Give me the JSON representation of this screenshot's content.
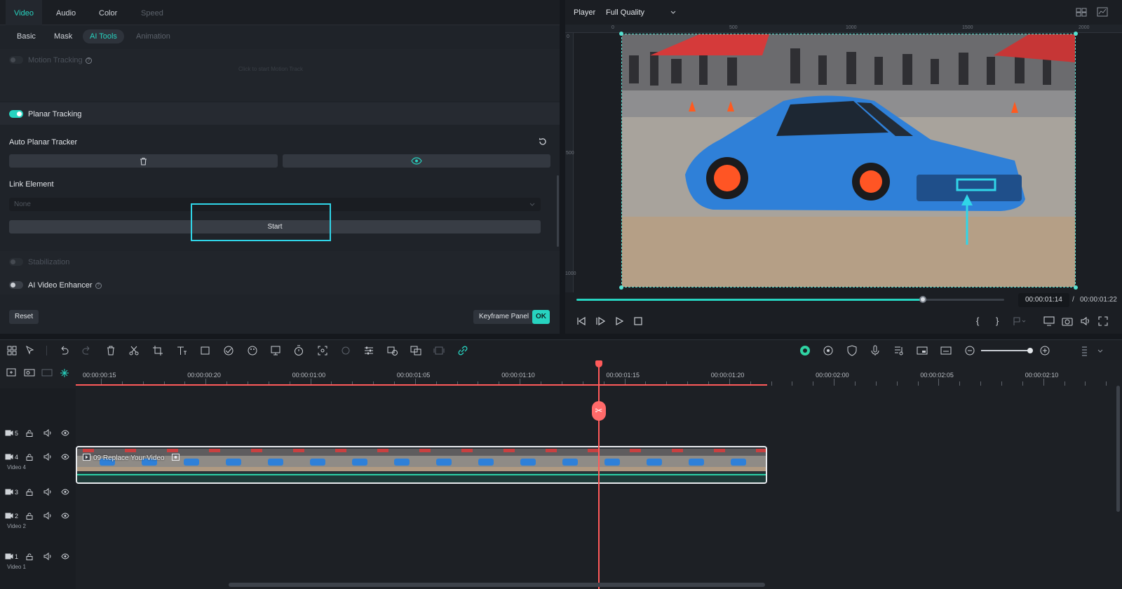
{
  "tabs": [
    "Video",
    "Audio",
    "Color",
    "Speed"
  ],
  "subtabs": [
    "Basic",
    "Mask",
    "AI Tools",
    "Animation"
  ],
  "sections": {
    "motion_tracking": "Motion Tracking",
    "motion_tracking_hint": "Click to start Motion Track",
    "planar_tracking": "Planar Tracking",
    "auto_planar_tracker": "Auto Planar Tracker",
    "link_element": "Link Element",
    "link_element_value": "None",
    "start_label": "Start",
    "stabilization": "Stabilization",
    "ai_video_enhancer": "AI Video Enhancer"
  },
  "footer": {
    "reset": "Reset",
    "keyframe_panel": "Keyframe Panel",
    "ok": "OK"
  },
  "player": {
    "label": "Player",
    "quality": "Full Quality",
    "current_time": "00:00:01:14",
    "separator": "/",
    "total_time": "00:00:01:22",
    "progress": 0.81,
    "ruler_h": [
      "0",
      "500",
      "1000",
      "1500",
      "2000"
    ],
    "ruler_v": [
      "0",
      "500",
      "1000"
    ]
  },
  "timeline": {
    "ruler_labels": [
      "00:00:00:15",
      "00:00:00:20",
      "00:00:01:00",
      "00:00:01:05",
      "00:00:01:10",
      "00:00:01:15",
      "00:00:01:20",
      "00:00:02:00",
      "00:00:02:05",
      "00:00:02:10"
    ],
    "tracks": [
      {
        "num": "5",
        "name": ""
      },
      {
        "num": "4",
        "name": "Video 4"
      },
      {
        "num": "3",
        "name": ""
      },
      {
        "num": "2",
        "name": "Video 2"
      },
      {
        "num": "1",
        "name": "Video 1"
      }
    ],
    "clip_title": "09 Replace Your Video"
  },
  "colors": {
    "accent": "#27d3c0",
    "playhead": "#ff5a5a",
    "highlight": "#30d5e8"
  }
}
